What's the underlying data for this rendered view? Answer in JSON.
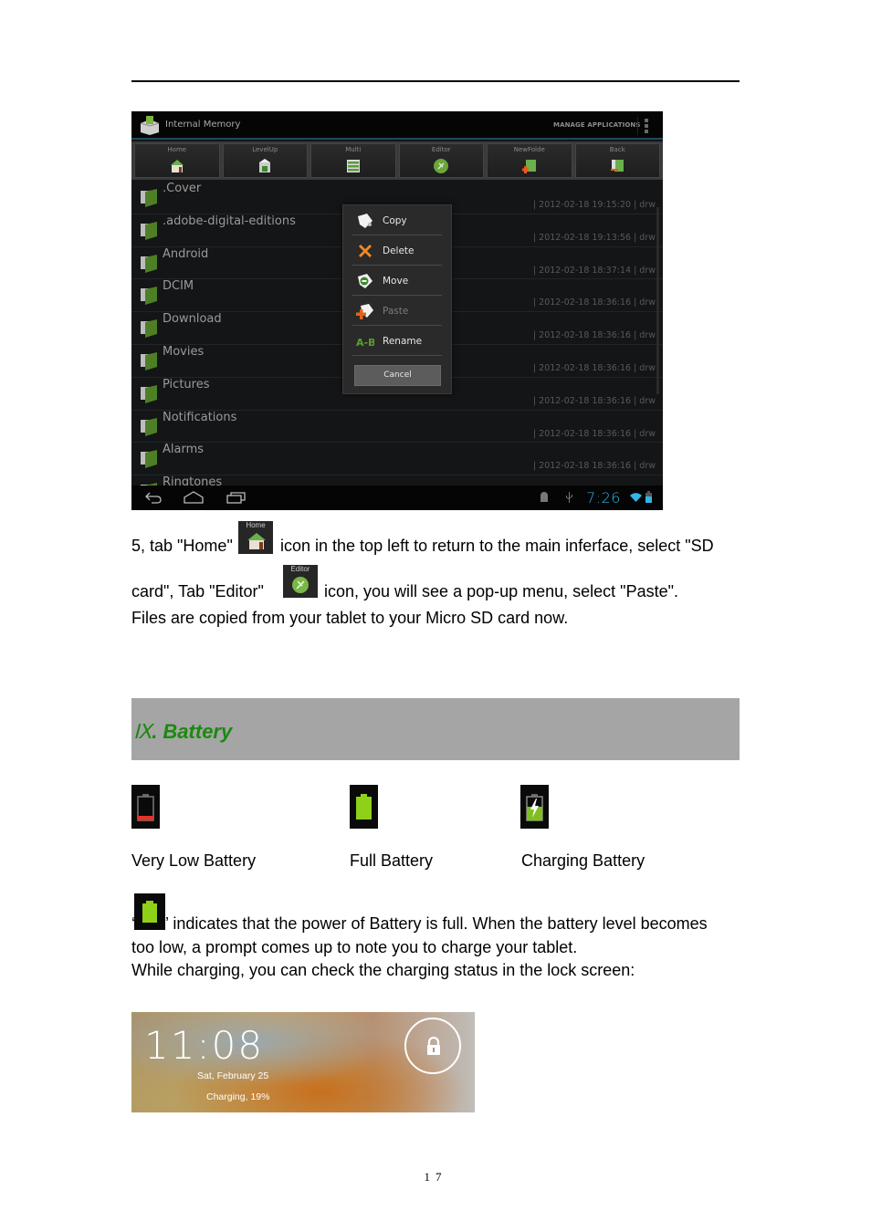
{
  "screenshot": {
    "app_title": "Internal Memory",
    "manage_apps": "MANAGE APPLICATIONS",
    "toolbar": [
      {
        "label": "Home",
        "icon": "home-icon"
      },
      {
        "label": "LevelUp",
        "icon": "level-up-icon"
      },
      {
        "label": "Multi",
        "icon": "multi-select-icon"
      },
      {
        "label": "Editor",
        "icon": "editor-icon"
      },
      {
        "label": "NewFolde",
        "icon": "new-folder-icon"
      },
      {
        "label": "Back",
        "icon": "back-icon"
      }
    ],
    "files": [
      {
        "name": ".Cover",
        "meta": "| 2012-02-18 19:15:20 | drw"
      },
      {
        "name": ".adobe-digital-editions",
        "meta": "| 2012-02-18 19:13:56 | drw"
      },
      {
        "name": "Android",
        "meta": "| 2012-02-18 18:37:14 | drw"
      },
      {
        "name": "DCIM",
        "meta": "| 2012-02-18 18:36:16 | drw"
      },
      {
        "name": "Download",
        "meta": "| 2012-02-18 18:36:16 | drw"
      },
      {
        "name": "Movies",
        "meta": "| 2012-02-18 18:36:16 | drw"
      },
      {
        "name": "Pictures",
        "meta": "| 2012-02-18 18:36:16 | drw"
      },
      {
        "name": "Notifications",
        "meta": "| 2012-02-18 18:36:16 | drw"
      },
      {
        "name": "Alarms",
        "meta": "| 2012-02-18 18:36:16 | drw"
      },
      {
        "name": "Ringtones",
        "meta": ""
      }
    ],
    "popup": {
      "items": [
        {
          "label": "Copy",
          "icon": "copy-icon",
          "enabled": true
        },
        {
          "label": "Delete",
          "icon": "delete-icon",
          "enabled": true
        },
        {
          "label": "Move",
          "icon": "move-icon",
          "enabled": true
        },
        {
          "label": "Paste",
          "icon": "paste-icon",
          "enabled": false
        },
        {
          "label": "Rename",
          "icon": "rename-icon",
          "enabled": true
        }
      ],
      "cancel": "Cancel"
    },
    "status_bar": {
      "time": "7:26",
      "accent": "#33b5e5"
    }
  },
  "text": {
    "step5_line1_a": "5, tab \"Home\"",
    "step5_line1_b": "icon in the top left to return to the main inferface, select \"SD",
    "step5_line2_a": "card\", Tab \"Editor\"",
    "step5_line2_b": "icon, you will see a pop-up menu, select \"Paste\".",
    "step5_line3": "Files are copied from your tablet to your Micro SD card now.",
    "home_icon_caption": "Home",
    "editor_icon_caption": "Editor"
  },
  "section": {
    "number": "Ⅸ",
    "title": ". Battery",
    "color": "#1a8a10"
  },
  "battery": {
    "states": [
      {
        "label": "Very Low Battery",
        "icon": "battery-low-icon"
      },
      {
        "label": "Full Battery",
        "icon": "battery-full-icon"
      },
      {
        "label": "Charging Battery",
        "icon": "battery-charging-icon"
      }
    ],
    "desc_line1": "’ indicates that the power of Battery is full. When the battery level becomes",
    "desc_open_quote": "‘",
    "desc_line2": "too low, a prompt comes up to note you to charge your tablet.",
    "desc_line3": "While charging, you can check the charging status in the lock screen:"
  },
  "lockscreen": {
    "time": "11:08",
    "date": "Sat, February 25",
    "status": "Charging, 19%"
  },
  "page_number": "17"
}
